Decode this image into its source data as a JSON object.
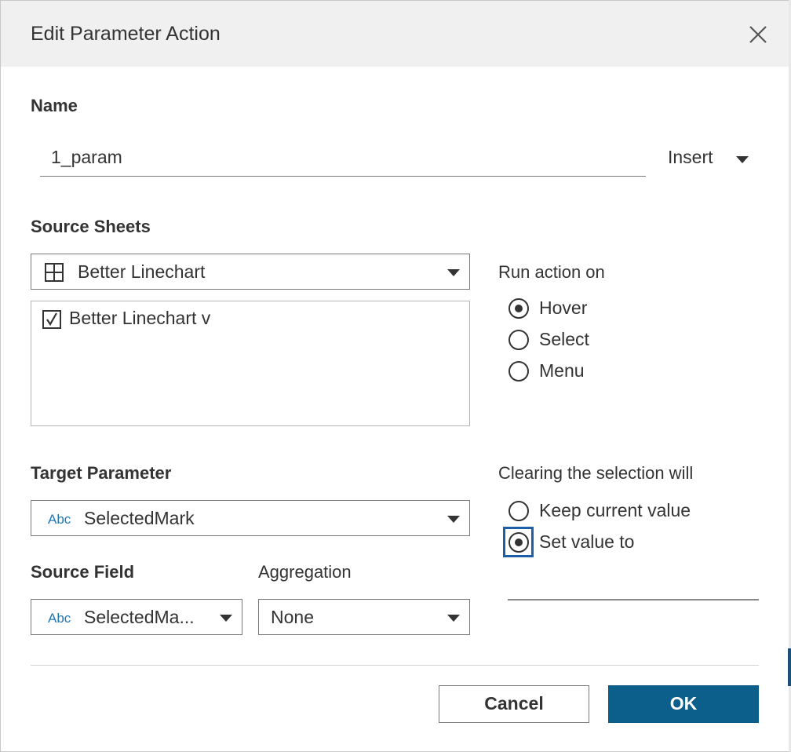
{
  "dialog": {
    "title": "Edit Parameter Action",
    "close_icon": "close-icon"
  },
  "name": {
    "label": "Name",
    "value": "1_param",
    "insert_label": "Insert"
  },
  "source_sheets": {
    "label": "Source Sheets",
    "selected_datasource": "Better Linechart",
    "datasource_icon": "worksheet-grid-icon",
    "sheets": [
      {
        "label": "Better Linechart v",
        "checked": true
      }
    ]
  },
  "run_action": {
    "label": "Run action on",
    "options": [
      {
        "label": "Hover",
        "selected": true
      },
      {
        "label": "Select",
        "selected": false
      },
      {
        "label": "Menu",
        "selected": false
      }
    ]
  },
  "target_parameter": {
    "label": "Target Parameter",
    "type_badge": "Abc",
    "value": "SelectedMark"
  },
  "source_field": {
    "label": "Source Field",
    "type_badge": "Abc",
    "value": "SelectedMa..."
  },
  "aggregation": {
    "label": "Aggregation",
    "value": "None"
  },
  "clearing": {
    "label": "Clearing the selection will",
    "options": [
      {
        "label": "Keep current value",
        "selected": false
      },
      {
        "label": "Set value to",
        "selected": true
      }
    ],
    "set_value": ""
  },
  "buttons": {
    "cancel": "Cancel",
    "ok": "OK"
  },
  "colors": {
    "accent": "#0b5f8a",
    "focus": "#1d5ea8",
    "type_badge": "#1f77b4"
  }
}
